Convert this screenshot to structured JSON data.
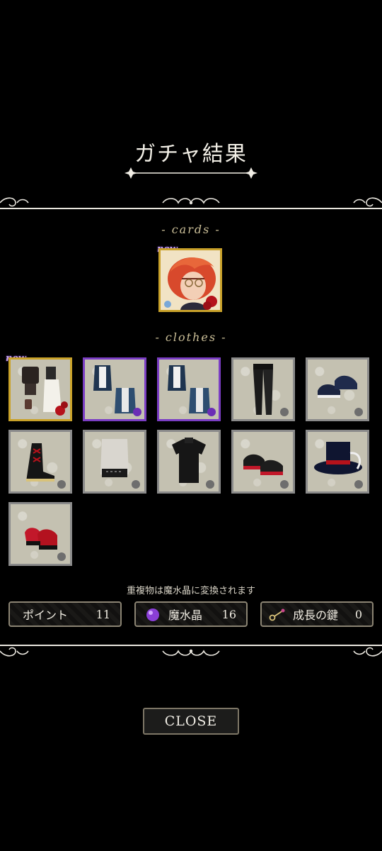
{
  "title": "ガチャ結果",
  "sections": {
    "cards_label": "- cards -",
    "clothes_label": "- clothes -"
  },
  "new_label": "new",
  "card": {
    "is_new": true
  },
  "clothes_items": [
    {
      "icon": "outfit-set-icon",
      "frame": "gold",
      "rarity": "rose",
      "new": true
    },
    {
      "icon": "blue-jacket-set-icon",
      "frame": "purple",
      "rarity": "purple-rose"
    },
    {
      "icon": "blue-jacket-set-icon",
      "frame": "purple",
      "rarity": "purple-rose"
    },
    {
      "icon": "black-pants-icon",
      "frame": "silver",
      "rarity": "silver-rose"
    },
    {
      "icon": "navy-shoes-icon",
      "frame": "silver",
      "rarity": "silver-rose"
    },
    {
      "icon": "laced-boots-icon",
      "frame": "silver",
      "rarity": "silver-rose"
    },
    {
      "icon": "white-shirt-icon",
      "frame": "silver",
      "rarity": "silver-rose"
    },
    {
      "icon": "black-shirt-icon",
      "frame": "silver",
      "rarity": "silver-rose"
    },
    {
      "icon": "red-sneakers-icon",
      "frame": "silver",
      "rarity": "silver-rose"
    },
    {
      "icon": "top-hat-icon",
      "frame": "silver",
      "rarity": "silver-rose"
    },
    {
      "icon": "red-heels-icon",
      "frame": "silver",
      "rarity": "silver-rose"
    }
  ],
  "notice": "重複物は魔水晶に変換されます",
  "currencies": {
    "points": {
      "label": "ポイント",
      "value": "11"
    },
    "crystal": {
      "label": "魔水晶",
      "value": "16"
    },
    "key": {
      "label": "成長の鍵",
      "value": "0"
    }
  },
  "close_label": "CLOSE",
  "colors": {
    "gold": "#c9a229",
    "purple": "#7b3ec4",
    "silver": "#8a8a8a",
    "background": "#000000"
  }
}
